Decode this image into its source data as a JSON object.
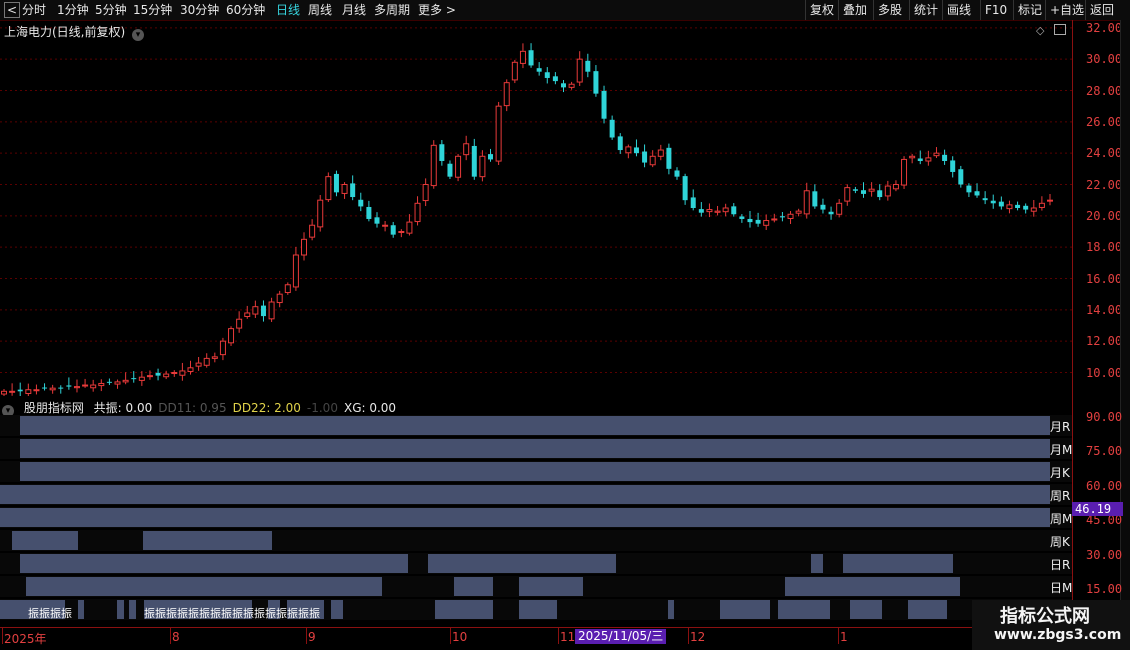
{
  "toolbar": {
    "left_items": [
      "分时",
      "1分钟",
      "5分钟",
      "15分钟",
      "30分钟",
      "60分钟",
      "日线",
      "周线",
      "月线",
      "多周期",
      "更多 >"
    ],
    "active": "日线",
    "right_items": [
      "复权",
      "叠加",
      "多股",
      "统计",
      "画线",
      "F10",
      "标记",
      "+自选",
      "返回"
    ]
  },
  "stock": {
    "title": "上海电力(日线,前复权)"
  },
  "price_axis": [
    "32.00",
    "30.00",
    "28.00",
    "26.00",
    "24.00",
    "22.00",
    "20.00",
    "18.00",
    "16.00",
    "14.00",
    "12.00",
    "10.00"
  ],
  "indicator": {
    "name": "股朋指标网",
    "values": [
      {
        "label": "共振: 0.00",
        "color": "#e8e8e8"
      },
      {
        "label": "DD11: 0.95",
        "color": "#555555"
      },
      {
        "label": "DD22: 2.00",
        "color": "#e0d24a"
      },
      {
        "label": "-1.00",
        "color": "#444444"
      },
      {
        "label": "XG: 0.00",
        "color": "#e8e8e8"
      }
    ],
    "axis": [
      "90.00",
      "75.00",
      "60.00",
      "45.00",
      "30.00",
      "15.00"
    ],
    "current_value": "46.19",
    "row_labels": [
      "月R",
      "月M",
      "月K",
      "周R",
      "周M",
      "周K",
      "日R",
      "日M"
    ],
    "bottom_text_1": "振振振振",
    "bottom_text_2": "振振振振振振振振振振振振振振振振"
  },
  "time_axis": {
    "labels": [
      "2025年",
      "8",
      "9",
      "10",
      "11",
      "12",
      "1"
    ],
    "cursor_date": "2025/11/05/三"
  },
  "watermark": {
    "line1": "指标公式网",
    "line2": "www.zbgs3.com"
  },
  "colors": {
    "up": "#e83a3a",
    "down": "#2fd4d8",
    "bar": "#46506e",
    "grid": "#5a0000"
  },
  "chart_data": {
    "type": "candlestick",
    "ylim": [
      8.5,
      32.5
    ],
    "close": [
      8.8,
      8.8,
      8.8,
      8.9,
      8.9,
      9.0,
      9.0,
      9.0,
      9.1,
      9.1,
      9.2,
      9.2,
      9.3,
      9.4,
      9.4,
      9.5,
      9.6,
      9.7,
      9.8,
      9.8,
      9.9,
      10.0,
      10.1,
      10.3,
      10.6,
      10.9,
      11.0,
      12.0,
      12.8,
      13.4,
      13.8,
      14.2,
      13.6,
      14.5,
      15.0,
      15.6,
      17.5,
      18.5,
      19.4,
      21.0,
      22.5,
      21.5,
      22.0,
      21.2,
      20.6,
      19.8,
      19.5,
      19.4,
      18.8,
      19.0,
      19.6,
      20.8,
      22.0,
      24.5,
      23.5,
      22.5,
      23.8,
      24.6,
      22.5,
      23.8,
      23.6,
      27.0,
      28.5,
      29.8,
      30.5,
      29.6,
      29.2,
      28.8,
      28.6,
      28.2,
      28.4,
      30.0,
      29.2,
      27.8,
      26.2,
      25.0,
      24.2,
      24.4,
      24.0,
      23.4,
      23.8,
      24.2,
      23.0,
      22.5,
      21.0,
      20.5,
      20.2,
      20.4,
      20.3,
      20.5,
      20.1,
      19.8,
      19.6,
      19.5,
      19.7,
      19.8,
      19.9,
      20.1,
      20.3,
      21.6,
      20.6,
      20.4,
      20.1,
      20.8,
      21.8,
      21.6,
      21.4,
      21.7,
      21.2,
      21.9,
      22.0,
      23.6,
      23.8,
      23.5,
      23.7,
      24.0,
      23.5,
      22.8,
      22.0,
      21.5,
      21.3,
      21.0,
      20.8,
      20.6,
      20.7,
      20.5,
      20.4,
      20.5,
      20.8,
      21.0
    ],
    "volume_rows": [
      "月R",
      "月M",
      "月K",
      "周R",
      "周M",
      "周K",
      "日R",
      "日M"
    ]
  }
}
